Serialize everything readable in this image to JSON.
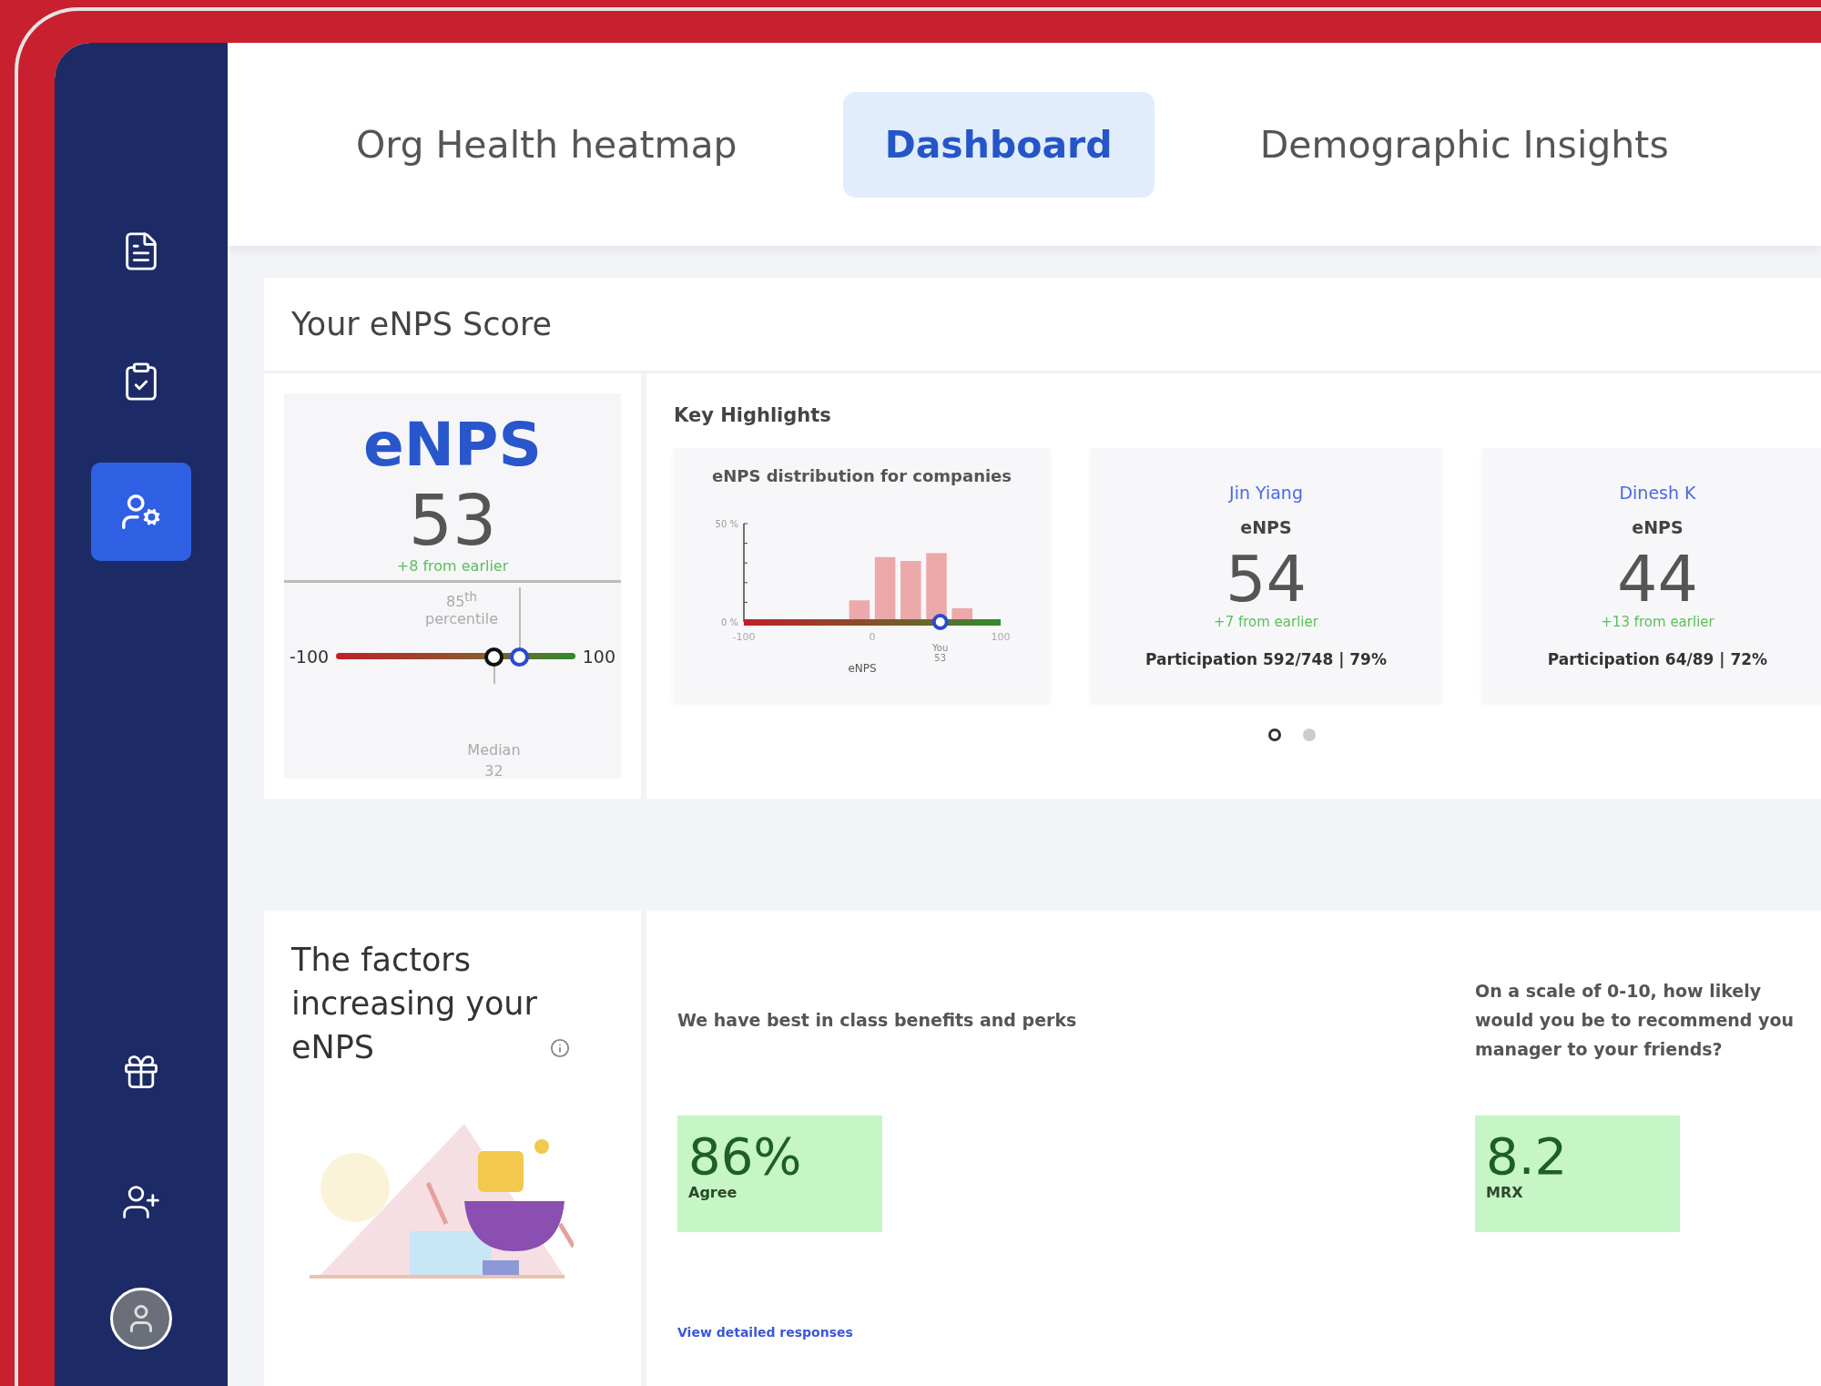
{
  "sidebar": {
    "top_items": [
      {
        "kind": "document",
        "selected": false
      },
      {
        "kind": "checklist",
        "selected": false
      },
      {
        "kind": "settings",
        "selected": true
      }
    ],
    "bottom_items": [
      {
        "kind": "gift",
        "selected": false
      },
      {
        "kind": "add-user",
        "selected": false
      }
    ]
  },
  "tabs": [
    {
      "label": "Org Health heatmap",
      "selected": false
    },
    {
      "label": "Dashboard",
      "selected": true
    },
    {
      "label": "Demographic Insights",
      "selected": false
    }
  ],
  "score_section": {
    "title": "Your eNPS Score",
    "score_card": {
      "label": "eNPS",
      "score": "53",
      "change": "+8 from earlier",
      "percentile": "85$^{th}$ percentile",
      "min_label": "-100",
      "max_label": "100",
      "median_label": "Median",
      "median_value": "32",
      "markers": [
        {
          "kind": "median",
          "level": 0.66
        },
        {
          "kind": "you",
          "level": 0.765
        }
      ]
    },
    "highlights": {
      "title": "Key Highlights",
      "chart_card": {
        "chart_data": {
          "type": "bar",
          "title": "eNPS distribution for companies",
          "xlabel": "eNPS",
          "x": [
            -10,
            10,
            30,
            50,
            70
          ],
          "values": [
            11,
            33,
            31,
            35,
            7
          ],
          "xlim": [
            -100,
            100
          ],
          "ylim": [
            0,
            50
          ],
          "xticks": [
            -100,
            0,
            100
          ],
          "yticks": [
            {
              "value": 0,
              "label": "0 %"
            },
            {
              "value": 50,
              "label": "50 %"
            }
          ],
          "annotations": [
            {
              "x": 53,
              "y": 0,
              "text": "You"
            },
            "53"
          ]
        }
      },
      "people": [
        {
          "name": "Jin Yiang",
          "label": "eNPS",
          "score": "54",
          "change": "+7 from earlier",
          "participation": "Participation 592/748 | 79%"
        },
        {
          "name": "Dinesh K",
          "label": "eNPS",
          "score": "44",
          "change": "+13 from earlier",
          "participation": "Participation 64/89 | 72%"
        }
      ],
      "pager": [
        {
          "selected": true
        },
        {
          "selected": false
        }
      ]
    }
  },
  "factors_section": {
    "title": "The factors increasing your eNPS",
    "items": [
      {
        "question_lines": [
          "We have best in class benefits and perks"
        ],
        "value": "86%",
        "value_label": "Agree",
        "link": "View detailed responses"
      },
      {
        "question_lines": [
          "On a scale of 0-10, how likely",
          "would you be to recommend you",
          "manager to your friends?"
        ],
        "value": "8.2",
        "value_label": "MRX"
      }
    ]
  }
}
